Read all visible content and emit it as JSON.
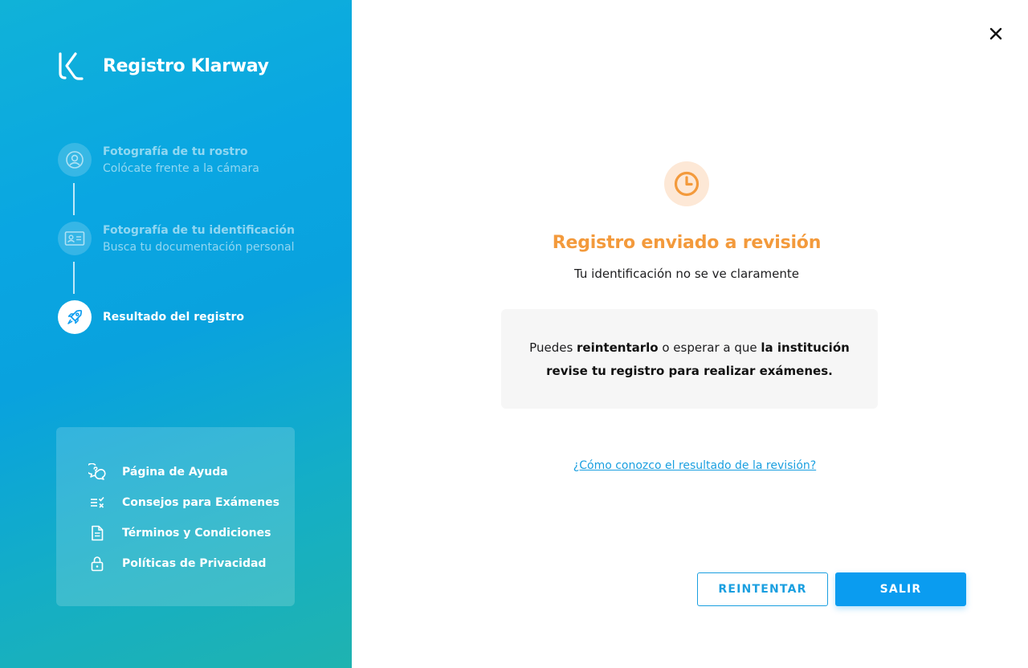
{
  "brand": {
    "title": "Registro Klarway"
  },
  "steps": [
    {
      "title": "Fotografía de tu rostro",
      "subtitle": "Colócate frente a la cámara",
      "icon": "face-icon",
      "state": "done"
    },
    {
      "title": "Fotografía de tu identificación",
      "subtitle": "Busca tu documentación personal",
      "icon": "id-card-icon",
      "state": "done"
    },
    {
      "title": "Resultado del registro",
      "subtitle": "",
      "icon": "rocket-icon",
      "state": "active"
    }
  ],
  "help": {
    "items": [
      {
        "label": "Página de Ayuda",
        "icon": "help-chat-icon"
      },
      {
        "label": "Consejos para Exámenes",
        "icon": "checklist-icon"
      },
      {
        "label": "Términos y Condiciones",
        "icon": "document-icon"
      },
      {
        "label": "Políticas de Privacidad",
        "icon": "lock-icon"
      }
    ]
  },
  "result": {
    "icon": "clock-icon",
    "title": "Registro enviado a revisión",
    "subtitle": "Tu identificación no se ve claramente",
    "message": {
      "part1": "Puedes ",
      "bold1": "reintentarlo",
      "part2": " o esperar a que ",
      "bold2": "la institución revise tu registro para realizar exámenes."
    },
    "help_link": "¿Cómo conozco el resultado de la revisión?"
  },
  "actions": {
    "retry_label": "REINTENTAR",
    "exit_label": "SALIR"
  },
  "colors": {
    "accent": "#0a9cf0",
    "warning": "#f39a3c",
    "warning_bg": "#fde8d6",
    "info_bg": "#f6f6f6"
  }
}
